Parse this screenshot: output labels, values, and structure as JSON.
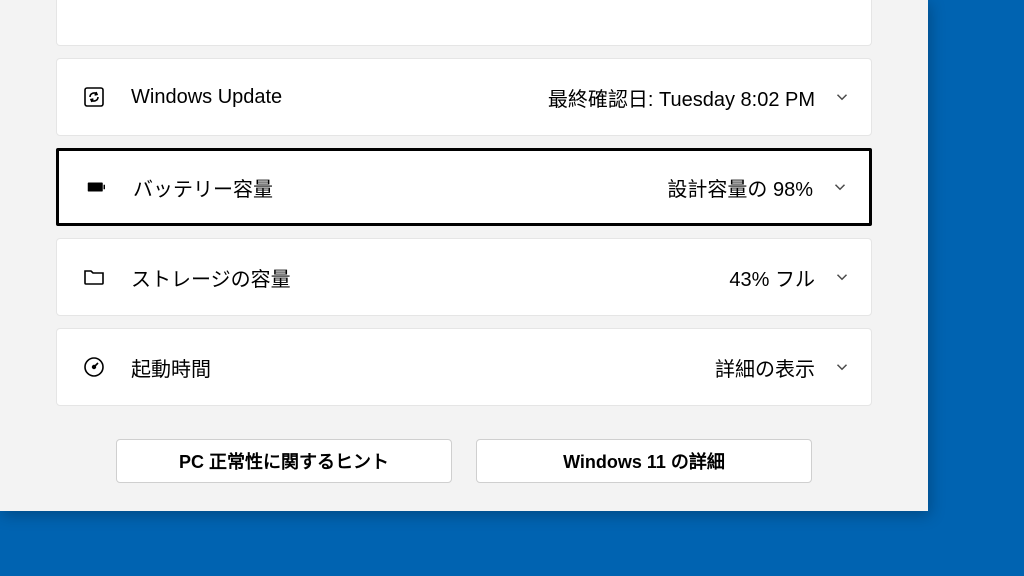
{
  "rows": {
    "windows_update": {
      "label": "Windows Update",
      "value": "最終確認日: Tuesday 8:02 PM"
    },
    "battery": {
      "label": "バッテリー容量",
      "value": "設計容量の 98%"
    },
    "storage": {
      "label": "ストレージの容量",
      "value": "43% フル"
    },
    "startup": {
      "label": "起動時間",
      "value": "詳細の表示"
    }
  },
  "footer": {
    "tips": "PC 正常性に関するヒント",
    "win11": "Windows 11 の詳細"
  }
}
